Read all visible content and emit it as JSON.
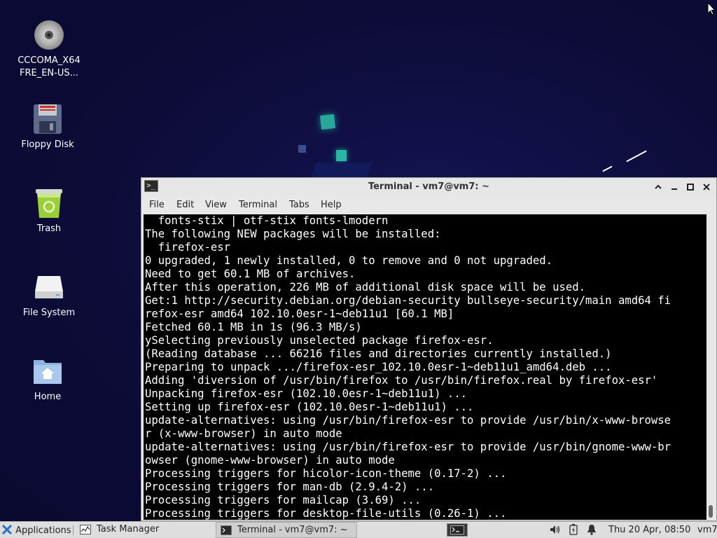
{
  "desktop": {
    "icons": [
      {
        "label": "CCCOMA_X64\nFRE_EN-US...",
        "icon": "optical-disc-icon"
      },
      {
        "label": "Floppy Disk",
        "icon": "floppy-disk-icon"
      },
      {
        "label": "Trash",
        "icon": "trash-icon"
      },
      {
        "label": "File System",
        "icon": "hard-drive-icon"
      },
      {
        "label": "Home",
        "icon": "home-folder-icon"
      }
    ]
  },
  "window": {
    "title": "Terminal - vm7@vm7: ~",
    "icon": "terminal-icon",
    "controls": {
      "shade": "⌃",
      "minimize": "–",
      "maximize": "□",
      "close": "✕"
    },
    "menu": [
      "File",
      "Edit",
      "View",
      "Terminal",
      "Tabs",
      "Help"
    ]
  },
  "terminal": {
    "lines": [
      "  fonts-stix | otf-stix fonts-lmodern",
      "The following NEW packages will be installed:",
      "  firefox-esr",
      "0 upgraded, 1 newly installed, 0 to remove and 0 not upgraded.",
      "Need to get 60.1 MB of archives.",
      "After this operation, 226 MB of additional disk space will be used.",
      "Get:1 http://security.debian.org/debian-security bullseye-security/main amd64 fi",
      "refox-esr amd64 102.10.0esr-1~deb11u1 [60.1 MB]",
      "Fetched 60.1 MB in 1s (96.3 MB/s)",
      "ySelecting previously unselected package firefox-esr.",
      "(Reading database ... 66216 files and directories currently installed.)",
      "Preparing to unpack .../firefox-esr_102.10.0esr-1~deb11u1_amd64.deb ...",
      "Adding 'diversion of /usr/bin/firefox to /usr/bin/firefox.real by firefox-esr'",
      "Unpacking firefox-esr (102.10.0esr-1~deb11u1) ...",
      "Setting up firefox-esr (102.10.0esr-1~deb11u1) ...",
      "update-alternatives: using /usr/bin/firefox-esr to provide /usr/bin/x-www-browse",
      "r (x-www-browser) in auto mode",
      "update-alternatives: using /usr/bin/firefox-esr to provide /usr/bin/gnome-www-br",
      "owser (gnome-www-browser) in auto mode",
      "Processing triggers for hicolor-icon-theme (0.17-2) ...",
      "Processing triggers for man-db (2.9.4-2) ...",
      "Processing triggers for mailcap (3.69) ...",
      "Processing triggers for desktop-file-utils (0.26-1) ..."
    ]
  },
  "taskbar": {
    "applications_label": "Applications",
    "applications_icon": "xfce-logo-icon",
    "tasks": [
      {
        "label": "Task Manager",
        "icon": "task-manager-icon"
      },
      {
        "label": "Terminal - vm7@vm7: ~",
        "icon": "terminal-icon"
      }
    ],
    "tray": {
      "volume_icon": "volume-icon",
      "battery_icon": "battery-icon",
      "notification_icon": "bell-icon"
    },
    "clock": "Thu 20 Apr, 08:50",
    "user": "vm7"
  },
  "colors": {
    "desktop_bg": "#0e0d3a",
    "terminal_bg": "#000000",
    "terminal_fg": "#ffffff",
    "taskbar_bg": "#dedede"
  }
}
